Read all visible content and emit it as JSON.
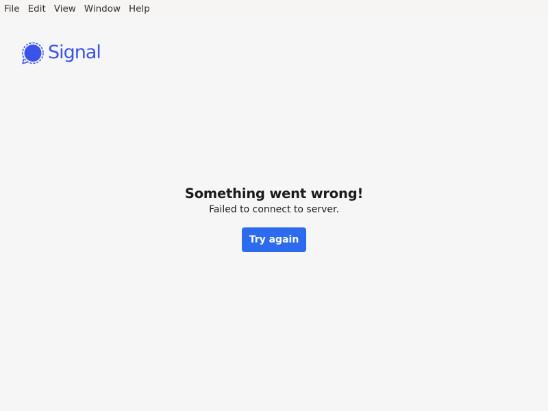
{
  "menubar": {
    "items": [
      {
        "label": "File"
      },
      {
        "label": "Edit"
      },
      {
        "label": "View"
      },
      {
        "label": "Window"
      },
      {
        "label": "Help"
      }
    ]
  },
  "logo": {
    "text": "Signal",
    "icon": "signal-chat-bubble-icon",
    "color": "#3a53e8"
  },
  "error": {
    "title": "Something went wrong!",
    "subtitle": "Failed to connect to server.",
    "button_label": "Try again",
    "button_color": "#2c6bed"
  }
}
